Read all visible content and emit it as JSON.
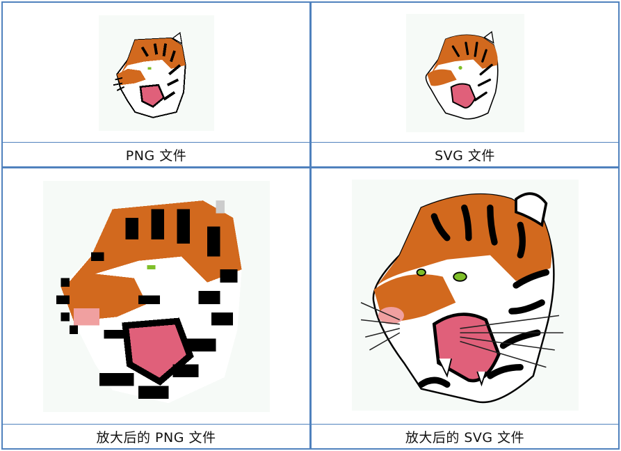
{
  "captions": {
    "top_left": "PNG 文件",
    "top_right": "SVG 文件",
    "bottom_left": "放大后的 PNG 文件",
    "bottom_right": "放大后的 SVG 文件"
  },
  "colors": {
    "border": "#4f81bd",
    "tiger_orange": "#d2691e",
    "tiger_black": "#000000",
    "tiger_white": "#ffffff",
    "tiger_nose": "#f0a0a0",
    "tiger_mouth": "#e0607a",
    "tiger_eye": "#7fbf2a",
    "image_bg": "#f6faf7"
  },
  "icons": {
    "tiger_small_png": "tiger-head-icon",
    "tiger_small_svg": "tiger-head-icon",
    "tiger_large_png": "pixelated-tiger-head-icon",
    "tiger_large_svg": "vector-tiger-head-icon"
  }
}
